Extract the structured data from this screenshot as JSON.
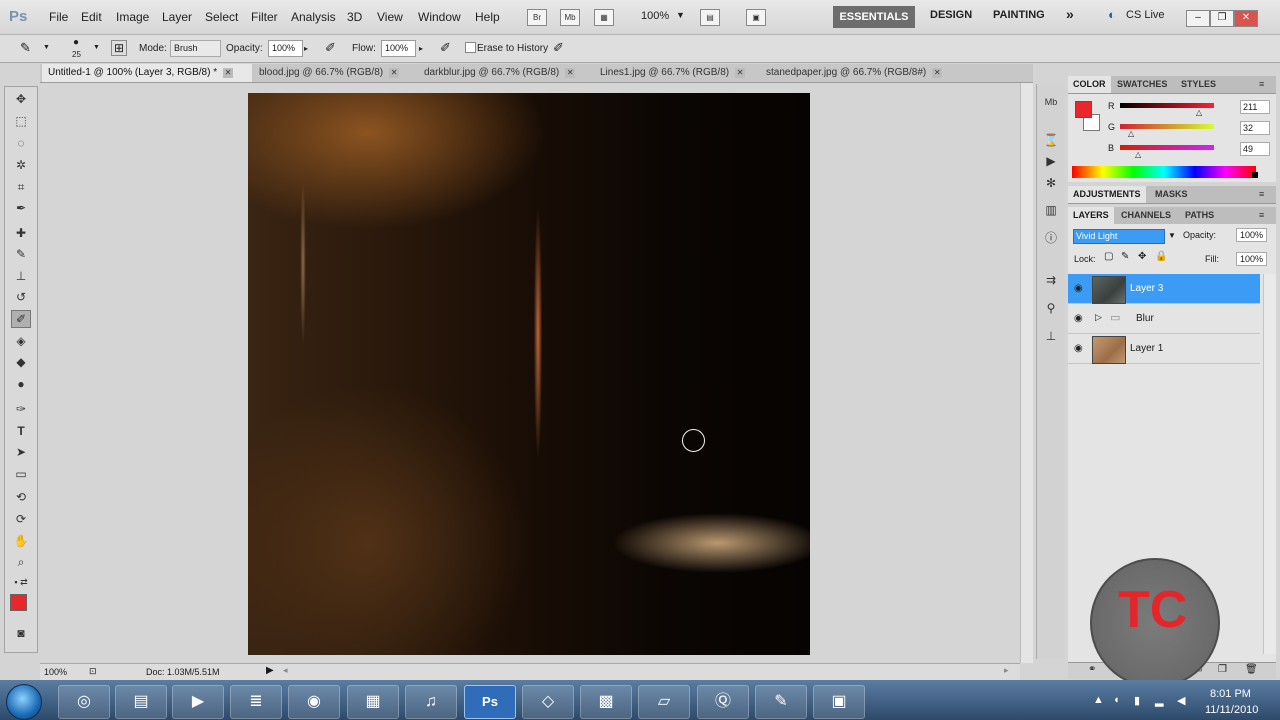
{
  "menubar": {
    "logo": "Ps",
    "items": [
      "File",
      "Edit",
      "Image",
      "Layer",
      "Select",
      "Filter",
      "Analysis",
      "3D",
      "View",
      "Window",
      "Help"
    ],
    "bridge_label": "Br",
    "mini_bridge_label": "Mb",
    "zoom": "100%",
    "workspaces": [
      "ESSENTIALS",
      "DESIGN",
      "PAINTING"
    ],
    "more": "»",
    "cs_live": "CS Live"
  },
  "options": {
    "brush_size": "25",
    "mode_label": "Mode:",
    "mode_value": "Brush",
    "opacity_label": "Opacity:",
    "opacity_value": "100%",
    "flow_label": "Flow:",
    "flow_value": "100%",
    "erase_history_label": "Erase to History"
  },
  "tabs": [
    {
      "label": "Untitled-1 @ 100% (Layer 3, RGB/8) *"
    },
    {
      "label": "blood.jpg @ 66.7% (RGB/8)"
    },
    {
      "label": "darkblur.jpg @ 66.7% (RGB/8)"
    },
    {
      "label": "Lines1.jpg @ 66.7% (RGB/8)"
    },
    {
      "label": "stanedpaper.jpg @ 66.7% (RGB/8#)"
    }
  ],
  "status": {
    "zoom": "100%",
    "doc": "Doc: 1.03M/5.51M"
  },
  "color_panel": {
    "tabs": [
      "COLOR",
      "SWATCHES",
      "STYLES"
    ],
    "foreground": "#e8262c",
    "r_label": "R",
    "r_value": "211",
    "g_label": "G",
    "g_value": "32",
    "b_label": "B",
    "b_value": "49"
  },
  "adjust_panel": {
    "tabs": [
      "ADJUSTMENTS",
      "MASKS"
    ]
  },
  "layers_panel": {
    "tabs": [
      "LAYERS",
      "CHANNELS",
      "PATHS"
    ],
    "blend_mode": "Vivid Light",
    "opacity_label": "Opacity:",
    "opacity_value": "100%",
    "lock_label": "Lock:",
    "fill_label": "Fill:",
    "fill_value": "100%",
    "layers": [
      {
        "name": "Layer 3"
      },
      {
        "name": "Blur"
      },
      {
        "name": "Layer 1"
      }
    ]
  },
  "watermark": "TC",
  "taskbar": {
    "time": "8:01 PM",
    "date": "11/11/2010"
  }
}
